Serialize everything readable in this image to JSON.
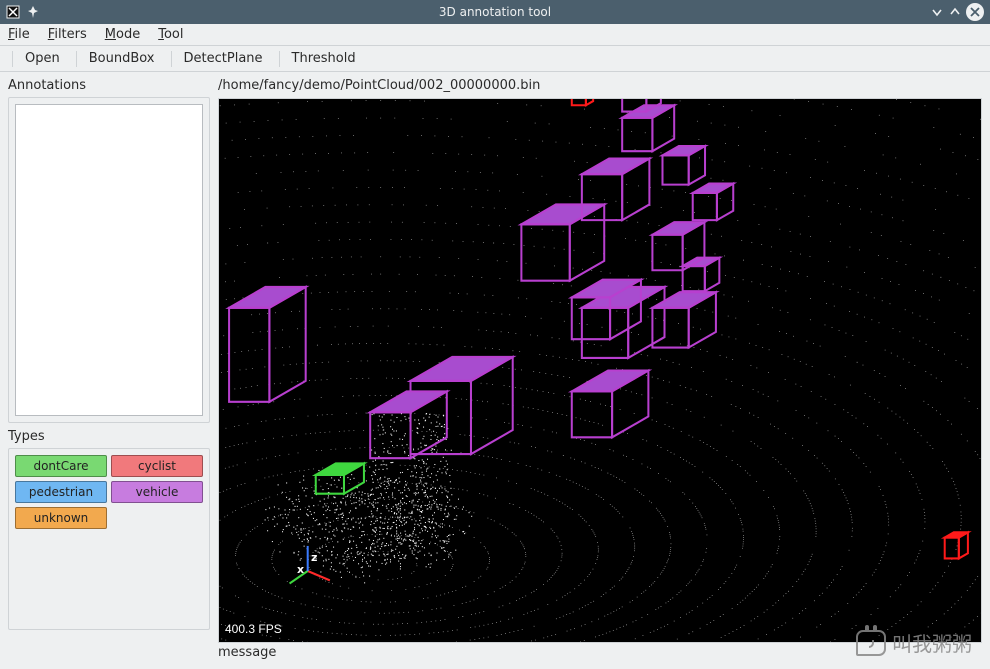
{
  "window": {
    "title": "3D annotation tool"
  },
  "menubar": {
    "items": [
      {
        "prefix": "F",
        "rest": "ile"
      },
      {
        "prefix": "F",
        "rest": "ilters"
      },
      {
        "prefix": "M",
        "rest": "ode"
      },
      {
        "prefix": "T",
        "rest": "ool"
      }
    ]
  },
  "toolbar": {
    "items": [
      "Open",
      "BoundBox",
      "DetectPlane",
      "Threshold"
    ]
  },
  "sidebar": {
    "annotations_title": "Annotations",
    "types_title": "Types",
    "types": [
      {
        "label": "dontCare",
        "bg": "#79d972"
      },
      {
        "label": "cyclist",
        "bg": "#f1797c"
      },
      {
        "label": "pedestrian",
        "bg": "#6fb7f2"
      },
      {
        "label": "vehicle",
        "bg": "#c77cdf"
      },
      {
        "label": "unknown",
        "bg": "#f2a94e"
      }
    ]
  },
  "main": {
    "path": "/home/fancy/demo/PointCloud/002_00000000.bin",
    "fps": "400.3 FPS",
    "axes": {
      "x": "x",
      "z": "z"
    },
    "message": "message"
  },
  "watermark": {
    "text": "叫我粥粥"
  },
  "viewer": {
    "colors": {
      "vehicle_stroke": "#b83fcf",
      "vehicle_fill": "#a84ccf",
      "cyclist": "#ff1a1a",
      "dontcare": "#3fd73f",
      "axis_x": "#ff2a2a",
      "axis_y": "#3fd73f",
      "axis_z": "#3a7bff",
      "point": "#ffffff"
    }
  }
}
